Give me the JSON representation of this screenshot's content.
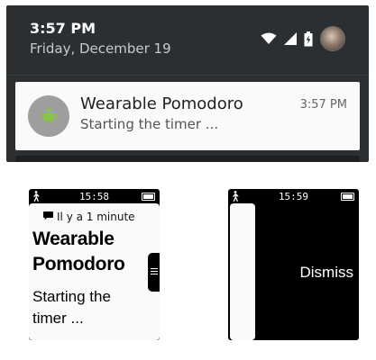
{
  "phone": {
    "status": {
      "time": "3:57 PM",
      "date": "Friday, December 19"
    },
    "icons": [
      "wifi-icon",
      "signal-icon",
      "battery-charging-icon",
      "avatar"
    ],
    "notification": {
      "app_icon": "android-icon",
      "title": "Wearable Pomodoro",
      "text": "Starting the timer ...",
      "time": "3:57 PM"
    }
  },
  "watch_left": {
    "status": {
      "time": "15:58",
      "icons": [
        "walk-icon",
        "battery-icon"
      ]
    },
    "card": {
      "meta_icon": "speech-bubble-icon",
      "meta_text": "Il y a 1 minute",
      "title": "Wearable Pomodoro",
      "body": "Starting the timer ..."
    },
    "action_tab_icon": "menu-icon"
  },
  "watch_right": {
    "status": {
      "time": "15:59",
      "icons": [
        "walk-icon",
        "battery-icon"
      ]
    },
    "dismiss_label": "Dismiss"
  },
  "colors": {
    "shade_bg": "#2b2f31",
    "card_bg": "#fafafa",
    "app_icon_circle": "#9e9e9e",
    "android_green": "#8bc34a",
    "watch_bg": "#000000"
  }
}
